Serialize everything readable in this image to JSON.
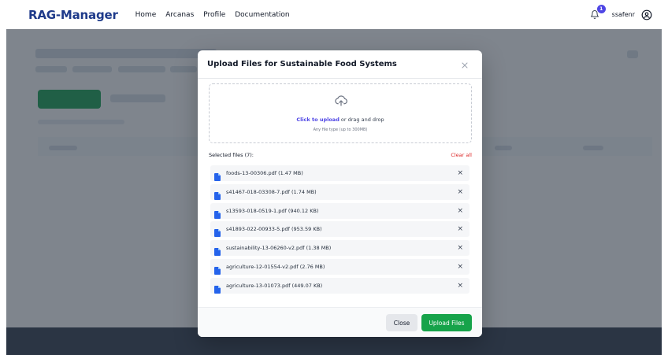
{
  "navbar": {
    "brand": "RAG-Manager",
    "links": [
      "Home",
      "Arcanas",
      "Profile",
      "Documentation"
    ],
    "notification_count": "1",
    "username": "ssafenr"
  },
  "modal": {
    "title": "Upload Files for Sustainable Food Systems",
    "dropzone": {
      "click_text": "Click to upload",
      "drag_text": " or drag and drop",
      "subtext": "Any file type (up to 300MB)"
    },
    "selected_label": "Selected files (7):",
    "clear_all": "Clear all",
    "files": [
      "foods-13-00306.pdf (1.47 MB)",
      "s41467-018-03308-7.pdf (1.74 MB)",
      "s13593-018-0519-1.pdf (940.12 KB)",
      "s41893-022-00933-5.pdf (953.59 KB)",
      "sustainability-13-06260-v2.pdf (1.38 MB)",
      "agriculture-12-01554-v2.pdf (2.76 MB)",
      "agriculture-13-01073.pdf (449.07 KB)"
    ],
    "remove_glyph": "×",
    "close_button": "Close",
    "upload_button": "Upload Files"
  },
  "colors": {
    "brand": "#1e3a8a",
    "accent": "#4f46e5",
    "primary_green": "#16a34a",
    "danger": "#dc2626"
  }
}
